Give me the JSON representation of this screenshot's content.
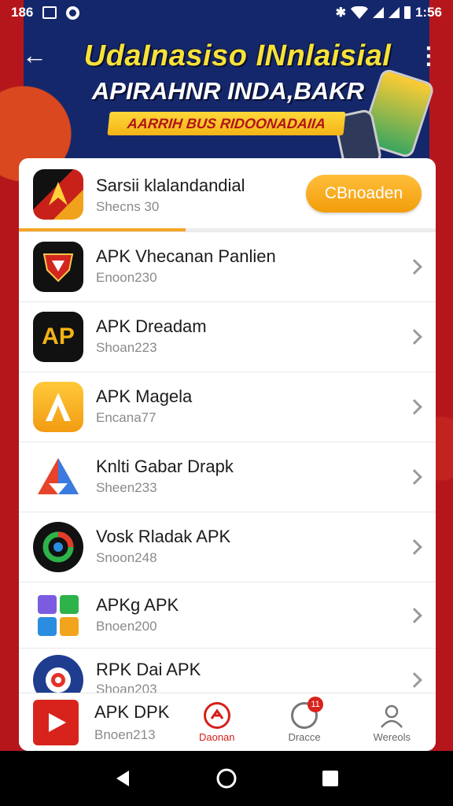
{
  "status_bar": {
    "left_time": "186",
    "right_time": "1:56",
    "icons": [
      "photo-icon",
      "circle-icon",
      "bluetooth-icon",
      "wifi-icon",
      "signal-icon",
      "signal-icon",
      "battery-icon"
    ]
  },
  "header": {
    "back_glyph": "←",
    "menu_glyph": "⋮",
    "banner_title": "UdaInasiso INnlaisial",
    "banner_subtitle": "APIRAHNR INDA,BAKR",
    "banner_tag": "AARRIH BUS RIDOONADAIIA"
  },
  "featured": {
    "name": "Sarsii klalandandial",
    "meta": "Shecns 30",
    "button_label": "CBnoaden",
    "progress": 0.4
  },
  "apps": [
    {
      "name": "APK Vhecanan Panlien",
      "meta": "Enoon230",
      "icon": "shield-app-icon"
    },
    {
      "name": "APK Dreadam",
      "meta": "Shoan223",
      "icon": "ap-app-icon"
    },
    {
      "name": "APK Magela",
      "meta": "Encana77",
      "icon": "a-logo-app-icon"
    },
    {
      "name": "Knlti Gabar Drapk",
      "meta": "Sheen233",
      "icon": "triangle-app-icon"
    },
    {
      "name": "Vosk Rladak APK",
      "meta": "Snoon248",
      "icon": "ring-app-icon"
    },
    {
      "name": "APKg APK",
      "meta": "Bnoen200",
      "icon": "grid-app-icon"
    },
    {
      "name": "RPK Dai APK",
      "meta": "Shoan203",
      "icon": "ball-app-icon"
    },
    {
      "name": "APK DPK",
      "meta": "Bnoen213",
      "icon": "play-app-icon"
    }
  ],
  "bottom_nav": [
    {
      "label": "Daonan",
      "icon": "home-icon",
      "active": true
    },
    {
      "label": "Dracce",
      "icon": "search-icon",
      "badge": "11"
    },
    {
      "label": "Wereols",
      "icon": "user-icon"
    }
  ],
  "colors": {
    "accent": "#f5a623",
    "nav_active": "#d4201c",
    "banner_yellow": "#f7e23a"
  }
}
